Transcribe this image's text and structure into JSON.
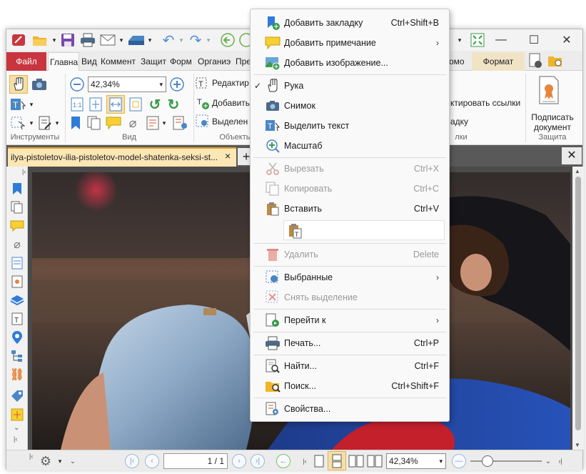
{
  "window": {
    "close_glyph": "✕",
    "maximize_glyph": "☐",
    "minimize_glyph": "—"
  },
  "tabs": {
    "file": "Файл",
    "home": "Главна",
    "view": "Вид",
    "comment": "Коммент",
    "protect": "Защит",
    "form": "Форм",
    "organize": "Органиэ",
    "convert": "Пре",
    "help_partial": "омо",
    "format": "Формат"
  },
  "ribbon": {
    "zoom_value": "42,34%",
    "edit_text": "Редактир",
    "add_text": "Добавить",
    "selected_text": "Выделен",
    "links_text": "ктировать ссылки",
    "partial_text": "адку",
    "sign_line1": "Подписать",
    "sign_line2": "документ",
    "group_tools": "Инструменты",
    "group_view": "Вид",
    "group_objects": "Объекты",
    "group_links": "лки",
    "group_protect": "Защита"
  },
  "document": {
    "tab_title": "ilya-pistoletov-ilia-pistoletov-model-shatenka-seksi-st...",
    "tab_close": "×",
    "new_tab": "+",
    "close_all": "✕"
  },
  "statusbar": {
    "page_value": "1 / 1",
    "zoom_value": "42,34%"
  },
  "menu": {
    "items": [
      {
        "label": "Добавить закладку",
        "shortcut": "Ctrl+Shift+B",
        "icon": "bookmark-add-icon"
      },
      {
        "label": "Добавить примечание",
        "arrow": "›",
        "icon": "note-add-icon"
      },
      {
        "label": "Добавить изображение...",
        "icon": "image-add-icon"
      },
      {
        "label": "Рука",
        "check": "✓",
        "icon": "hand-icon"
      },
      {
        "label": "Снимок",
        "icon": "camera-icon"
      },
      {
        "label": "Выделить текст",
        "icon": "select-text-icon"
      },
      {
        "label": "Масштаб",
        "icon": "zoom-icon"
      },
      {
        "label": "Вырезать",
        "shortcut": "Ctrl+X",
        "icon": "scissors-icon",
        "disabled": true
      },
      {
        "label": "Копировать",
        "shortcut": "Ctrl+C",
        "icon": "copy-icon",
        "disabled": true
      },
      {
        "label": "Вставить",
        "shortcut": "Ctrl+V",
        "icon": "paste-icon"
      },
      {
        "label": "Удалить",
        "shortcut": "Delete",
        "icon": "trash-icon",
        "disabled": true
      },
      {
        "label": "Выбранные",
        "arrow": "›",
        "icon": "selected-icon"
      },
      {
        "label": "Снять выделение",
        "icon": "deselect-icon",
        "disabled": true
      },
      {
        "label": "Перейти к",
        "arrow": "›",
        "icon": "goto-icon"
      },
      {
        "label": "Печать...",
        "shortcut": "Ctrl+P",
        "icon": "printer-icon"
      },
      {
        "label": "Найти...",
        "shortcut": "Ctrl+F",
        "icon": "find-icon"
      },
      {
        "label": "Поиск...",
        "shortcut": "Ctrl+Shift+F",
        "icon": "search-folder-icon"
      },
      {
        "label": "Свойства...",
        "icon": "properties-icon"
      }
    ]
  },
  "colors": {
    "accent_red": "#c8353f",
    "doc_tab": "#fbe6b5",
    "format_tab": "#f1e3c5"
  }
}
